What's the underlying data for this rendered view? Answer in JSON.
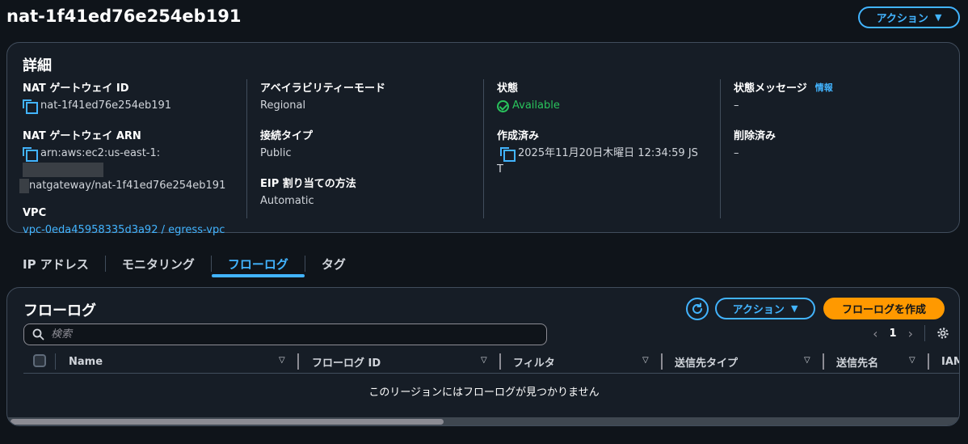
{
  "page_title": "nat-1f41ed76e254eb191",
  "header_actions_label": "アクション",
  "details": {
    "title": "詳細",
    "col1": {
      "nat_id_label": "NAT ゲートウェイ ID",
      "nat_id_value": "nat-1f41ed76e254eb191",
      "arn_label": "NAT ゲートウェイ ARN",
      "arn_line1": "arn:aws:ec2:us-east-1:",
      "arn_line2": "natgateway/nat-1f41ed76e254eb191",
      "vpc_label": "VPC",
      "vpc_value": "vpc-0eda45958335d3a92 / egress-vpc"
    },
    "col2": {
      "az_mode_label": "アベイラビリティーモード",
      "az_mode_value": "Regional",
      "conn_type_label": "接続タイプ",
      "conn_type_value": "Public",
      "eip_method_label": "EIP 割り当ての方法",
      "eip_method_value": "Automatic"
    },
    "col3": {
      "state_label": "状態",
      "state_value": "Available",
      "created_label": "作成済み",
      "created_line1": "2025年11月20日木曜日 12:34:59 JS",
      "created_line2": "T"
    },
    "col4": {
      "state_msg_label": "状態メッセージ",
      "info_link": "情報",
      "state_msg_value": "–",
      "deleted_label": "削除済み",
      "deleted_value": "–"
    }
  },
  "tabs": [
    {
      "label": "IP アドレス"
    },
    {
      "label": "モニタリング"
    },
    {
      "label": "フローログ"
    },
    {
      "label": "タグ"
    }
  ],
  "flowlogs": {
    "title": "フローログ",
    "actions_label": "アクション",
    "create_label": "フローログを作成",
    "search_placeholder": "検索",
    "page_number": "1",
    "columns": [
      "Name",
      "フローログ ID",
      "フィルタ",
      "送信先タイプ",
      "送信先名",
      "IAM"
    ],
    "empty_message": "このリージョンにはフローログが見つかりません"
  },
  "colors": {
    "accent": "#42b4ff",
    "primary": "#ff9900",
    "success": "#29c35c",
    "background": "#0f141a",
    "panel": "#161d26"
  },
  "icons": [
    "copy-icon",
    "check-circle-icon",
    "refresh-icon",
    "search-icon",
    "chevron-left-icon",
    "chevron-right-icon",
    "gear-icon",
    "sort-down-icon",
    "caret-down-icon"
  ]
}
